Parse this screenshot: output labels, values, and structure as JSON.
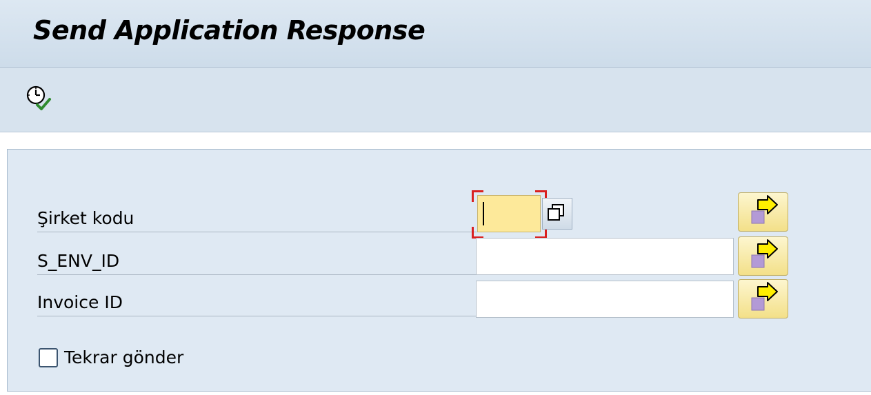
{
  "header": {
    "title": "Send Application Response"
  },
  "toolbar": {
    "execute_icon": "clock-execute-icon"
  },
  "form": {
    "fields": [
      {
        "label": "Şirket kodu",
        "value": "",
        "placeholder": ""
      },
      {
        "label": "S_ENV_ID",
        "value": "",
        "placeholder": ""
      },
      {
        "label": "Invoice ID",
        "value": "",
        "placeholder": ""
      }
    ],
    "checkbox": {
      "label": "Tekrar gönder",
      "checked": false
    }
  },
  "colors": {
    "title_bar": "#cddcea",
    "toolbar": "#d7e3ee",
    "form_background": "#dfe9f3",
    "required_field": "#fde99a",
    "focus_bracket": "#d92020",
    "multi_button": "#f3e089"
  }
}
